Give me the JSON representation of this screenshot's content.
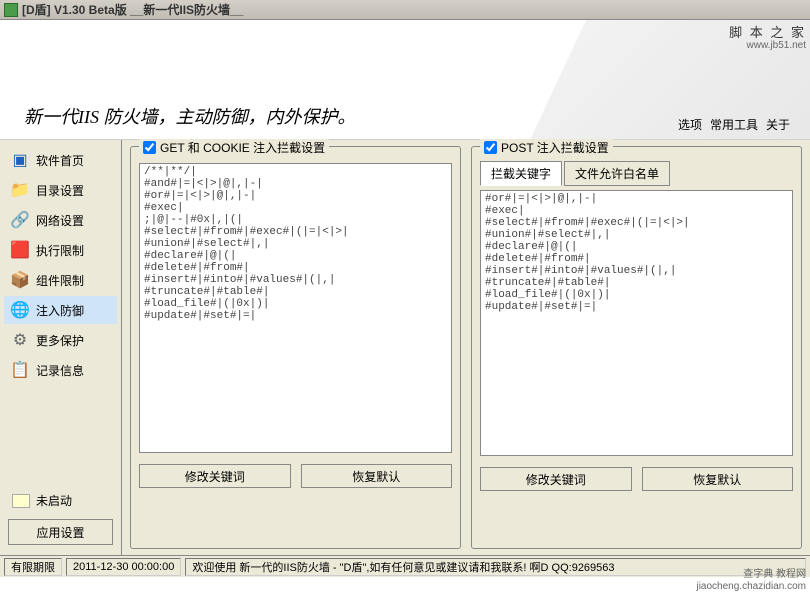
{
  "titlebar": "[D盾] V1.30 Beta版    __新一代IIS防火墙__",
  "watermark_top": "脚 本 之 家",
  "watermark_url": "www.jb51.net",
  "slogan": "新一代IIS 防火墙，主动防御，内外保护。",
  "menu": {
    "m1": "选项",
    "m2": "常用工具",
    "m3": "关于"
  },
  "nav": {
    "n0": "软件首页",
    "n1": "目录设置",
    "n2": "网络设置",
    "n3": "执行限制",
    "n4": "组件限制",
    "n5": "注入防御",
    "n6": "更多保护",
    "n7": "记录信息"
  },
  "status_label": "未启动",
  "apply_label": "应用设置",
  "group1": {
    "title": "GET 和 COOKIE 注入拦截设置",
    "text": "/**|**/|\n#and#|=|<|>|@|,|-|\n#or#|=|<|>|@|,|-|\n#exec|\n;|@|--|#0x|,|(|\n#select#|#from#|#exec#|(|=|<|>|\n#union#|#select#|,|\n#declare#|@|(|\n#delete#|#from#|\n#insert#|#into#|#values#|(|,|\n#truncate#|#table#|\n#load_file#|(|0x|)|\n#update#|#set#|=|",
    "btn1": "修改关键词",
    "btn2": "恢复默认"
  },
  "group2": {
    "title": "POST 注入拦截设置",
    "tab1": "拦截关键字",
    "tab2": "文件允许白名单",
    "text": "#or#|=|<|>|@|,|-|\n#exec|\n#select#|#from#|#exec#|(|=|<|>|\n#union#|#select#|,|\n#declare#|@|(|\n#delete#|#from#|\n#insert#|#into#|#values#|(|,|\n#truncate#|#table#|\n#load_file#|(|0x|)|\n#update#|#set#|=|",
    "btn1": "修改关键词",
    "btn2": "恢复默认"
  },
  "statusbar": {
    "s1": "有限期限",
    "s2": "2011-12-30 00:00:00",
    "s3": "欢迎使用 新一代的IIS防火墙 - \"D盾\",如有任何意见或建议请和我联系!    啊D  QQ:9269563"
  },
  "watermark_br1": "查字典 教程网",
  "watermark_br2": "jiaocheng.chazidian.com"
}
